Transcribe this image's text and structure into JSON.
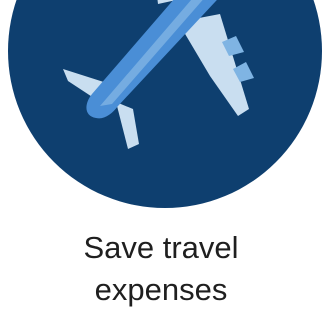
{
  "feature": {
    "caption_line1": "Save travel",
    "caption_line2": "expenses",
    "icon": "airplane-icon",
    "colors": {
      "circle": "#0e3f6f",
      "plane_light": "#c9def0",
      "plane_mid": "#7fb4e3",
      "plane_blue": "#4a8ed6",
      "text": "#1f1f1f"
    }
  }
}
